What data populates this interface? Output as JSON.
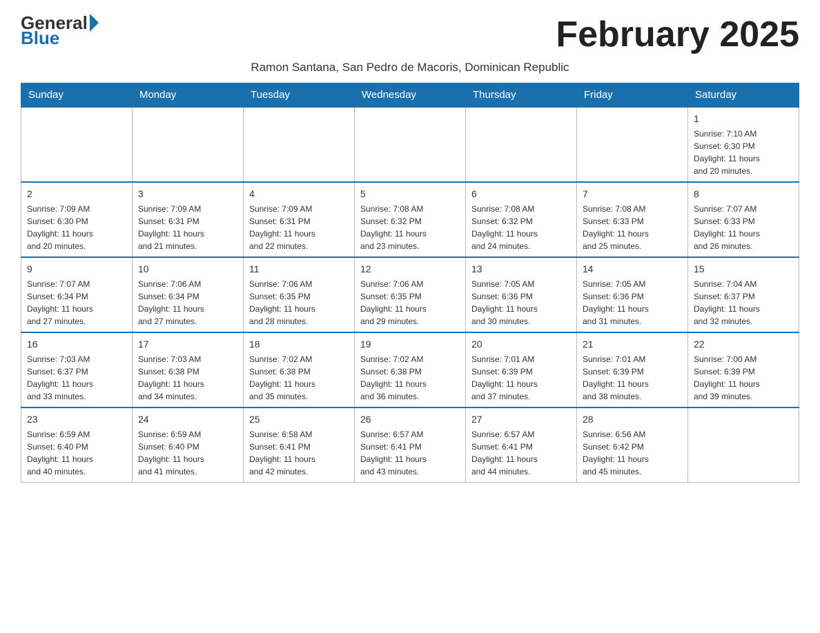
{
  "header": {
    "logo_line1": "General",
    "logo_line2": "Blue",
    "month_title": "February 2025",
    "subtitle": "Ramon Santana, San Pedro de Macoris, Dominican Republic"
  },
  "calendar": {
    "days_of_week": [
      "Sunday",
      "Monday",
      "Tuesday",
      "Wednesday",
      "Thursday",
      "Friday",
      "Saturday"
    ],
    "weeks": [
      [
        {
          "day": "",
          "info": ""
        },
        {
          "day": "",
          "info": ""
        },
        {
          "day": "",
          "info": ""
        },
        {
          "day": "",
          "info": ""
        },
        {
          "day": "",
          "info": ""
        },
        {
          "day": "",
          "info": ""
        },
        {
          "day": "1",
          "info": "Sunrise: 7:10 AM\nSunset: 6:30 PM\nDaylight: 11 hours\nand 20 minutes."
        }
      ],
      [
        {
          "day": "2",
          "info": "Sunrise: 7:09 AM\nSunset: 6:30 PM\nDaylight: 11 hours\nand 20 minutes."
        },
        {
          "day": "3",
          "info": "Sunrise: 7:09 AM\nSunset: 6:31 PM\nDaylight: 11 hours\nand 21 minutes."
        },
        {
          "day": "4",
          "info": "Sunrise: 7:09 AM\nSunset: 6:31 PM\nDaylight: 11 hours\nand 22 minutes."
        },
        {
          "day": "5",
          "info": "Sunrise: 7:08 AM\nSunset: 6:32 PM\nDaylight: 11 hours\nand 23 minutes."
        },
        {
          "day": "6",
          "info": "Sunrise: 7:08 AM\nSunset: 6:32 PM\nDaylight: 11 hours\nand 24 minutes."
        },
        {
          "day": "7",
          "info": "Sunrise: 7:08 AM\nSunset: 6:33 PM\nDaylight: 11 hours\nand 25 minutes."
        },
        {
          "day": "8",
          "info": "Sunrise: 7:07 AM\nSunset: 6:33 PM\nDaylight: 11 hours\nand 26 minutes."
        }
      ],
      [
        {
          "day": "9",
          "info": "Sunrise: 7:07 AM\nSunset: 6:34 PM\nDaylight: 11 hours\nand 27 minutes."
        },
        {
          "day": "10",
          "info": "Sunrise: 7:06 AM\nSunset: 6:34 PM\nDaylight: 11 hours\nand 27 minutes."
        },
        {
          "day": "11",
          "info": "Sunrise: 7:06 AM\nSunset: 6:35 PM\nDaylight: 11 hours\nand 28 minutes."
        },
        {
          "day": "12",
          "info": "Sunrise: 7:06 AM\nSunset: 6:35 PM\nDaylight: 11 hours\nand 29 minutes."
        },
        {
          "day": "13",
          "info": "Sunrise: 7:05 AM\nSunset: 6:36 PM\nDaylight: 11 hours\nand 30 minutes."
        },
        {
          "day": "14",
          "info": "Sunrise: 7:05 AM\nSunset: 6:36 PM\nDaylight: 11 hours\nand 31 minutes."
        },
        {
          "day": "15",
          "info": "Sunrise: 7:04 AM\nSunset: 6:37 PM\nDaylight: 11 hours\nand 32 minutes."
        }
      ],
      [
        {
          "day": "16",
          "info": "Sunrise: 7:03 AM\nSunset: 6:37 PM\nDaylight: 11 hours\nand 33 minutes."
        },
        {
          "day": "17",
          "info": "Sunrise: 7:03 AM\nSunset: 6:38 PM\nDaylight: 11 hours\nand 34 minutes."
        },
        {
          "day": "18",
          "info": "Sunrise: 7:02 AM\nSunset: 6:38 PM\nDaylight: 11 hours\nand 35 minutes."
        },
        {
          "day": "19",
          "info": "Sunrise: 7:02 AM\nSunset: 6:38 PM\nDaylight: 11 hours\nand 36 minutes."
        },
        {
          "day": "20",
          "info": "Sunrise: 7:01 AM\nSunset: 6:39 PM\nDaylight: 11 hours\nand 37 minutes."
        },
        {
          "day": "21",
          "info": "Sunrise: 7:01 AM\nSunset: 6:39 PM\nDaylight: 11 hours\nand 38 minutes."
        },
        {
          "day": "22",
          "info": "Sunrise: 7:00 AM\nSunset: 6:39 PM\nDaylight: 11 hours\nand 39 minutes."
        }
      ],
      [
        {
          "day": "23",
          "info": "Sunrise: 6:59 AM\nSunset: 6:40 PM\nDaylight: 11 hours\nand 40 minutes."
        },
        {
          "day": "24",
          "info": "Sunrise: 6:59 AM\nSunset: 6:40 PM\nDaylight: 11 hours\nand 41 minutes."
        },
        {
          "day": "25",
          "info": "Sunrise: 6:58 AM\nSunset: 6:41 PM\nDaylight: 11 hours\nand 42 minutes."
        },
        {
          "day": "26",
          "info": "Sunrise: 6:57 AM\nSunset: 6:41 PM\nDaylight: 11 hours\nand 43 minutes."
        },
        {
          "day": "27",
          "info": "Sunrise: 6:57 AM\nSunset: 6:41 PM\nDaylight: 11 hours\nand 44 minutes."
        },
        {
          "day": "28",
          "info": "Sunrise: 6:56 AM\nSunset: 6:42 PM\nDaylight: 11 hours\nand 45 minutes."
        },
        {
          "day": "",
          "info": ""
        }
      ]
    ]
  }
}
